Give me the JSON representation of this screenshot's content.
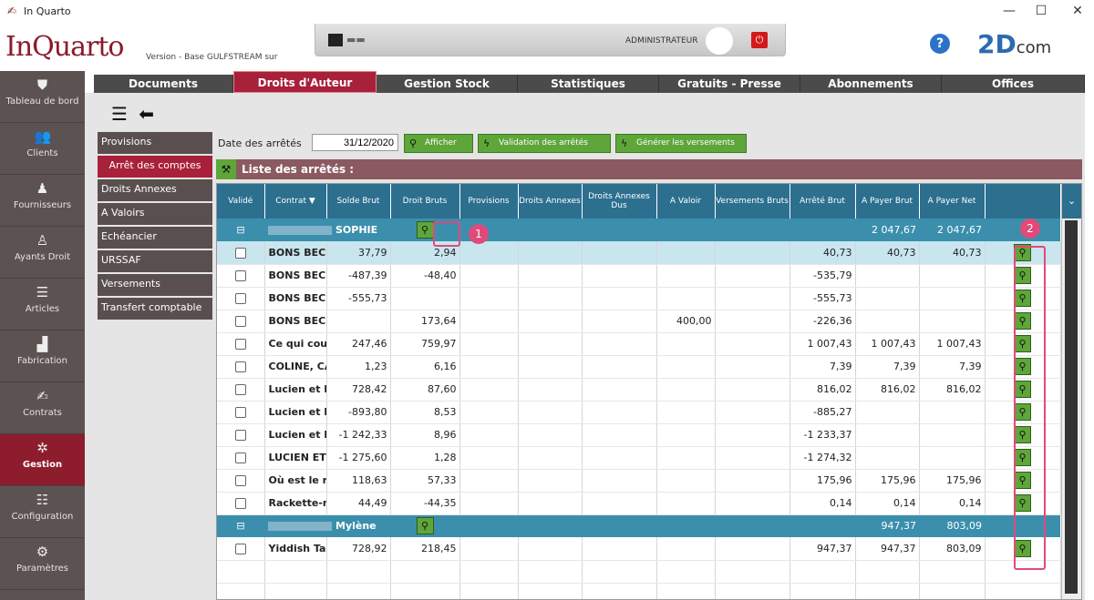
{
  "window": {
    "title": "In Quarto",
    "minimize": "—",
    "maximize": "☐",
    "close": "✕"
  },
  "header": {
    "logo": "InQuarto",
    "version": "Version  - Base GULFSTREAM sur",
    "admin": "ADMINISTRATEUR",
    "help": "?",
    "brand": "2D",
    "brand_suffix": "com"
  },
  "sidebar": [
    {
      "label": "Tableau de bord",
      "icon": "shield-icon"
    },
    {
      "label": "Clients",
      "icon": "users-icon"
    },
    {
      "label": "Fournisseurs",
      "icon": "supplier-icon"
    },
    {
      "label": "Ayants Droit",
      "icon": "person-icon"
    },
    {
      "label": "Articles",
      "icon": "books-icon"
    },
    {
      "label": "Fabrication",
      "icon": "factory-icon"
    },
    {
      "label": "Contrats",
      "icon": "handshake-icon"
    },
    {
      "label": "Gestion",
      "icon": "network-icon",
      "active": true
    },
    {
      "label": "Configuration",
      "icon": "sliders-icon"
    },
    {
      "label": "Paramètres",
      "icon": "gears-icon"
    }
  ],
  "tabs": [
    "Documents",
    "Droits d'Auteur",
    "Gestion Stock",
    "Statistiques",
    "Gratuits - Presse",
    "Abonnements",
    "Offices"
  ],
  "active_tab": "Droits d'Auteur",
  "submenu": [
    "Provisions",
    "Arrêt des comptes",
    "Droits Annexes",
    "A Valoirs",
    "Echéancier",
    "URSSAF",
    "Versements",
    "Transfert comptable"
  ],
  "filters": {
    "date_label": "Date des arrêtés",
    "date_value": "31/12/2020",
    "btn_afficher": "Afficher",
    "btn_validation": "Validation des arrêtés",
    "btn_generer": "Générer les versements"
  },
  "list_title": "Liste des arrêtés :",
  "columns": [
    "Validé",
    "Contrat",
    "Solde Brut",
    "Droit Bruts",
    "Provisions",
    "Droits Annexes",
    "Droits Annexes Dus",
    "A Valoir",
    "Versements Bruts",
    "Arrêté Brut",
    "A Payer Brut",
    "A Payer Net"
  ],
  "groups": [
    {
      "name": "SOPHIE",
      "apayer_brut": "2 047,67",
      "apayer_net": "2 047,67",
      "rows": [
        {
          "contrat": "BONS BECS",
          "solde": "37,79",
          "droit": "2,94",
          "avaloir": "",
          "arrete": "40,73",
          "brut": "40,73",
          "net": "40,73",
          "selected": true
        },
        {
          "contrat": "BONS BECS",
          "solde": "-487,39",
          "droit": "-48,40",
          "avaloir": "",
          "arrete": "-535,79",
          "brut": "",
          "net": ""
        },
        {
          "contrat": "BONS BECS",
          "solde": "-555,73",
          "droit": "",
          "avaloir": "",
          "arrete": "-555,73",
          "brut": "",
          "net": ""
        },
        {
          "contrat": "BONS BECS",
          "solde": "",
          "droit": "173,64",
          "avaloir": "400,00",
          "arrete": "-226,36",
          "brut": "",
          "net": ""
        },
        {
          "contrat": "Ce qui coul",
          "solde": "247,46",
          "droit": "759,97",
          "avaloir": "",
          "arrete": "1 007,43",
          "brut": "1 007,43",
          "net": "1 007,43"
        },
        {
          "contrat": "COLINE, CA",
          "solde": "1,23",
          "droit": "6,16",
          "avaloir": "",
          "arrete": "7,39",
          "brut": "7,39",
          "net": "7,39"
        },
        {
          "contrat": "Lucien et H",
          "solde": "728,42",
          "droit": "87,60",
          "avaloir": "",
          "arrete": "816,02",
          "brut": "816,02",
          "net": "816,02"
        },
        {
          "contrat": "Lucien et H",
          "solde": "-893,80",
          "droit": "8,53",
          "avaloir": "",
          "arrete": "-885,27",
          "brut": "",
          "net": ""
        },
        {
          "contrat": "Lucien et H",
          "solde": "-1 242,33",
          "droit": "8,96",
          "avaloir": "",
          "arrete": "-1 233,37",
          "brut": "",
          "net": ""
        },
        {
          "contrat": "LUCIEN ET",
          "solde": "-1 275,60",
          "droit": "1,28",
          "avaloir": "",
          "arrete": "-1 274,32",
          "brut": "",
          "net": ""
        },
        {
          "contrat": "Où est le re",
          "solde": "118,63",
          "droit": "57,33",
          "avaloir": "",
          "arrete": "175,96",
          "brut": "175,96",
          "net": "175,96"
        },
        {
          "contrat": "Rackette-m",
          "solde": "44,49",
          "droit": "-44,35",
          "avaloir": "",
          "arrete": "0,14",
          "brut": "0,14",
          "net": "0,14"
        }
      ]
    },
    {
      "name": "Mylène",
      "apayer_brut": "947,37",
      "apayer_net": "803,09",
      "rows": [
        {
          "contrat": "Yiddish Tar",
          "solde": "728,92",
          "droit": "218,45",
          "avaloir": "",
          "arrete": "947,37",
          "brut": "947,37",
          "net": "803,09"
        }
      ]
    }
  ],
  "markers": [
    "1",
    "2"
  ],
  "colors": {
    "accent": "#a8203a",
    "green": "#5fa63a",
    "header_blue": "#2c6f8e",
    "group_blue": "#3b8fad",
    "annotation": "#e04a7a"
  }
}
